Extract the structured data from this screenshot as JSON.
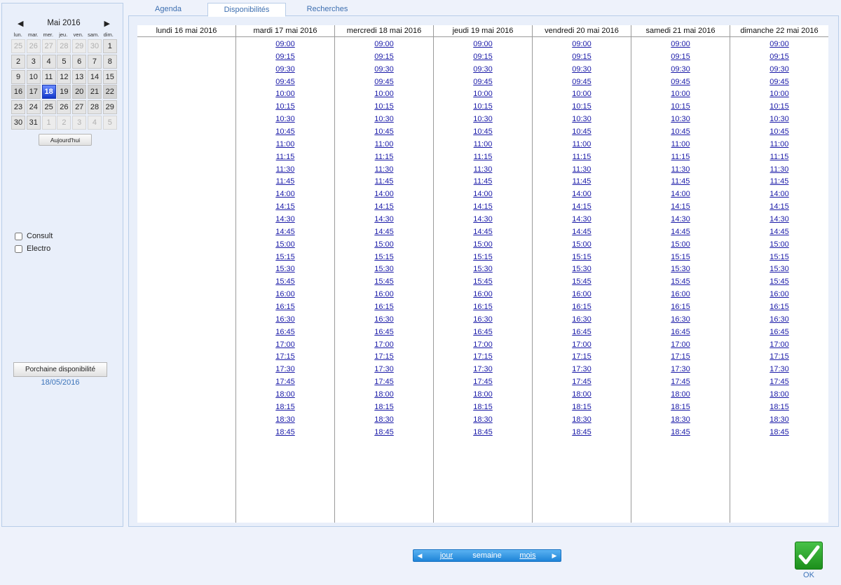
{
  "calendar": {
    "title": "Mai 2016",
    "prev_symbol": "◀",
    "next_symbol": "▶",
    "weekdays": [
      "lun.",
      "mar.",
      "mer.",
      "jeu.",
      "ven.",
      "sam.",
      "dim."
    ],
    "weeks": [
      [
        {
          "d": "25",
          "o": true
        },
        {
          "d": "26",
          "o": true
        },
        {
          "d": "27",
          "o": true
        },
        {
          "d": "28",
          "o": true
        },
        {
          "d": "29",
          "o": true
        },
        {
          "d": "30",
          "o": true
        },
        {
          "d": "1",
          "o": false
        }
      ],
      [
        {
          "d": "2",
          "o": false
        },
        {
          "d": "3",
          "o": false
        },
        {
          "d": "4",
          "o": false
        },
        {
          "d": "5",
          "o": false
        },
        {
          "d": "6",
          "o": false
        },
        {
          "d": "7",
          "o": false
        },
        {
          "d": "8",
          "o": false
        }
      ],
      [
        {
          "d": "9",
          "o": false
        },
        {
          "d": "10",
          "o": false
        },
        {
          "d": "11",
          "o": false
        },
        {
          "d": "12",
          "o": false
        },
        {
          "d": "13",
          "o": false
        },
        {
          "d": "14",
          "o": false
        },
        {
          "d": "15",
          "o": false
        }
      ],
      [
        {
          "d": "16",
          "o": false
        },
        {
          "d": "17",
          "o": false
        },
        {
          "d": "18",
          "o": false
        },
        {
          "d": "19",
          "o": false
        },
        {
          "d": "20",
          "o": false
        },
        {
          "d": "21",
          "o": false
        },
        {
          "d": "22",
          "o": false
        }
      ],
      [
        {
          "d": "23",
          "o": false
        },
        {
          "d": "24",
          "o": false
        },
        {
          "d": "25",
          "o": false
        },
        {
          "d": "26",
          "o": false
        },
        {
          "d": "27",
          "o": false
        },
        {
          "d": "28",
          "o": false
        },
        {
          "d": "29",
          "o": false
        }
      ],
      [
        {
          "d": "30",
          "o": false
        },
        {
          "d": "31",
          "o": false
        },
        {
          "d": "1",
          "o": true
        },
        {
          "d": "2",
          "o": true
        },
        {
          "d": "3",
          "o": true
        },
        {
          "d": "4",
          "o": true
        },
        {
          "d": "5",
          "o": true
        }
      ]
    ],
    "selected_day": "18",
    "today_label": "Aujourd'hui"
  },
  "filters": [
    {
      "label": "Consult",
      "checked": false
    },
    {
      "label": "Electro",
      "checked": false
    }
  ],
  "next_availability": {
    "button_label": "Porchaine disponibilité",
    "date": "18/05/2016"
  },
  "tabs": [
    {
      "label": "Agenda",
      "active": false
    },
    {
      "label": "Disponibilités",
      "active": true
    },
    {
      "label": "Recherches",
      "active": false
    }
  ],
  "days": [
    {
      "label": "lundi 16 mai 2016",
      "has_slots": false
    },
    {
      "label": "mardi 17 mai 2016",
      "has_slots": true
    },
    {
      "label": "mercredi 18 mai 2016",
      "has_slots": true
    },
    {
      "label": "jeudi 19 mai 2016",
      "has_slots": true
    },
    {
      "label": "vendredi 20 mai 2016",
      "has_slots": true
    },
    {
      "label": "samedi 21 mai 2016",
      "has_slots": true
    },
    {
      "label": "dimanche 22 mai 2016",
      "has_slots": true
    }
  ],
  "time_slots": [
    "09:00",
    "09:15",
    "09:30",
    "09:45",
    "10:00",
    "10:15",
    "10:30",
    "10:45",
    "11:00",
    "11:15",
    "11:30",
    "11:45",
    "14:00",
    "14:15",
    "14:30",
    "14:45",
    "15:00",
    "15:15",
    "15:30",
    "15:45",
    "16:00",
    "16:15",
    "16:30",
    "16:45",
    "17:00",
    "17:15",
    "17:30",
    "17:45",
    "18:00",
    "18:15",
    "18:30",
    "18:45"
  ],
  "view_nav": {
    "prev_symbol": "◀",
    "next_symbol": "▶",
    "day_label": "jour",
    "week_label": "semaine",
    "month_label": "mois"
  },
  "ok_label": "OK",
  "colors": {
    "link": "#1a1aa8",
    "accent": "#3b73b9",
    "selected_day": "#1237c9",
    "ok_green": "#2aa52a"
  }
}
